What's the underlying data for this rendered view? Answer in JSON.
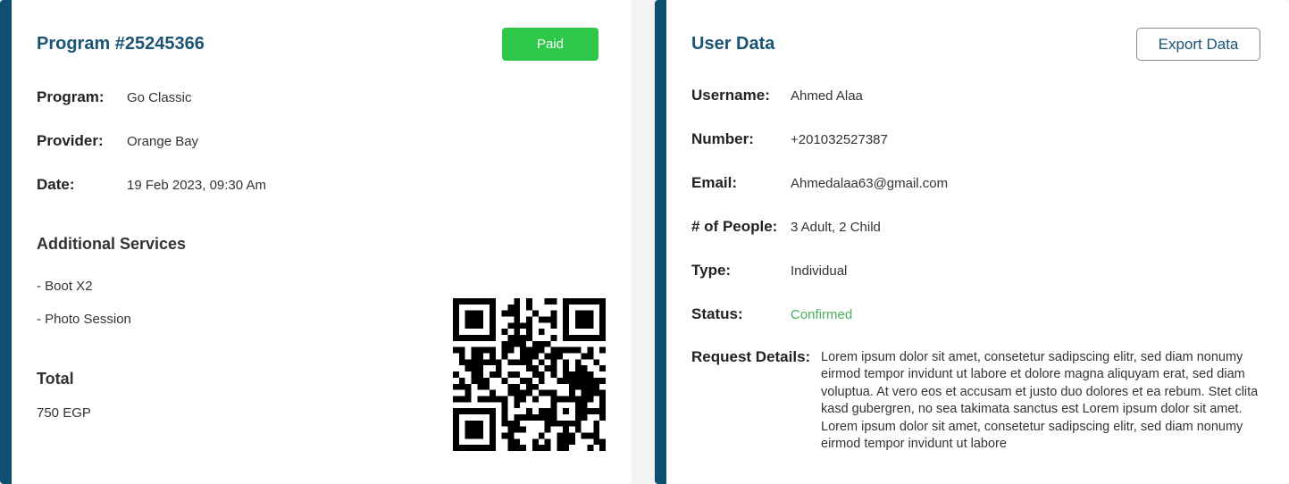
{
  "program_card": {
    "title": "Program #25245366",
    "status_badge": "Paid",
    "fields": {
      "program_label": "Program:",
      "program_value": "Go Classic",
      "provider_label": "Provider:",
      "provider_value": "Orange Bay",
      "date_label": "Date:",
      "date_value": "19 Feb 2023, 09:30 Am"
    },
    "additional_services_heading": "Additional Services",
    "services": [
      "- Boot X2",
      "- Photo Session"
    ],
    "total_heading": "Total",
    "total_value": "750 EGP",
    "colors": {
      "accent": "#0e4f72",
      "paid": "#2dc84a"
    }
  },
  "user_card": {
    "title": "User Data",
    "export_button": "Export Data",
    "fields": {
      "username_label": "Username:",
      "username_value": "Ahmed Alaa",
      "number_label": "Number:",
      "number_value": "+201032527387",
      "email_label": "Email:",
      "email_value": "Ahmedalaa63@gmail.com",
      "people_label": "# of People:",
      "people_value": "3 Adult, 2 Child",
      "type_label": "Type:",
      "type_value": "Individual",
      "status_label": "Status:",
      "status_value": "Confirmed",
      "request_label": "Request Details:",
      "request_value": "Lorem ipsum dolor sit amet, consetetur sadipscing elitr, sed diam nonumy eirmod tempor invidunt ut labore et dolore magna aliquyam erat, sed diam voluptua. At vero eos et accusam et justo duo dolores et ea rebum. Stet clita kasd gubergren, no sea takimata sanctus est Lorem ipsum dolor sit amet. Lorem ipsum dolor sit amet, consetetur sadipscing elitr, sed diam nonumy eirmod tempor invidunt ut labore"
    },
    "colors": {
      "confirmed": "#4bae5a"
    }
  },
  "icons": {
    "qr": "qr-code-icon"
  }
}
